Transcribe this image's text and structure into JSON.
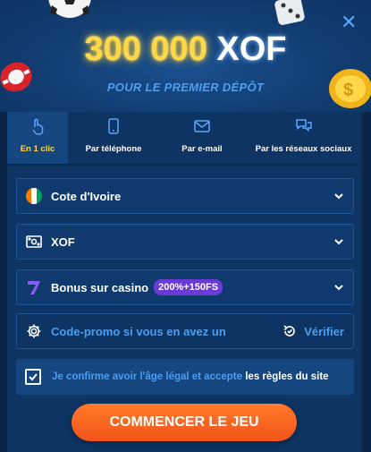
{
  "header": {
    "amount": "300 000",
    "currency": "XOF",
    "subtitle": "POUR LE PREMIER DÉPÔT"
  },
  "close_label": "✕",
  "tabs": [
    {
      "label": "En 1 clic",
      "icon": "tap-hand-icon",
      "active": true
    },
    {
      "label": "Par téléphone",
      "icon": "phone-icon",
      "active": false
    },
    {
      "label": "Par e-mail",
      "icon": "envelope-icon",
      "active": false
    },
    {
      "label": "Par les réseaux sociaux",
      "icon": "chat-bubbles-icon",
      "active": false
    }
  ],
  "fields": {
    "country": {
      "value": "Cote d'Ivoire",
      "icon": "cote-divoire-flag-icon"
    },
    "currency": {
      "value": "XOF",
      "icon": "banknote-icon"
    },
    "bonus": {
      "value": "Bonus sur casino",
      "badge": "200%+150FS",
      "icon": "seven-icon"
    }
  },
  "promo": {
    "placeholder": "Code-promo si vous en avez un",
    "verify_label": "Vérifier"
  },
  "consent": {
    "text": "Je confirme avoir l'âge légal et accepte ",
    "link": "les règles du site",
    "checked": true
  },
  "cta_label": "COMMENCER LE JEU",
  "colors": {
    "background": "#0e3463",
    "accent_yellow": "#ffd84a",
    "link_blue": "#4c9ef0",
    "cta_orange": "#f2541a",
    "badge_purple": "#6a3ad6"
  }
}
